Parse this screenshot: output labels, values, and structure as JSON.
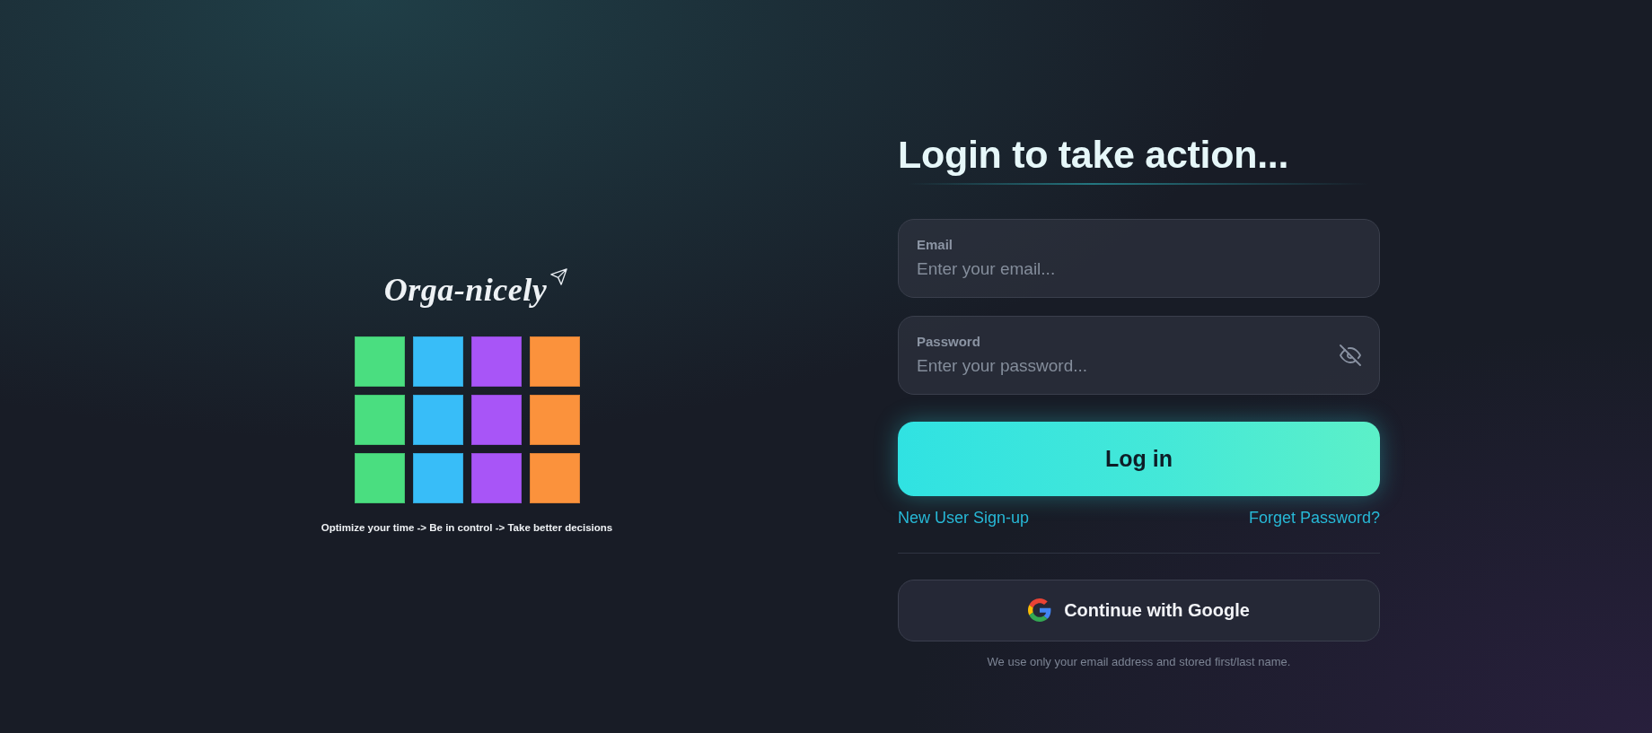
{
  "logo": {
    "wordmark": "Orga-nicely",
    "tile_rows": [
      {
        "tiles": [
          {
            "color": "#4ade80"
          },
          {
            "color": "#38bdf8"
          },
          {
            "color": "#a855f7"
          },
          {
            "color": "#fb923c"
          }
        ]
      },
      {
        "tiles": [
          {
            "color": "#4ade80"
          },
          {
            "color": "#38bdf8"
          },
          {
            "color": "#a855f7"
          },
          {
            "color": "#fb923c"
          }
        ]
      },
      {
        "tiles": [
          {
            "color": "#4ade80"
          },
          {
            "color": "#38bdf8"
          },
          {
            "color": "#a855f7"
          },
          {
            "color": "#fb923c"
          }
        ]
      }
    ],
    "tagline": "Optimize your time -> Be in control -> Take better decisions"
  },
  "login": {
    "title": "Login to take action...",
    "fields": [
      {
        "kind": "email",
        "label": "Email",
        "placeholder": "Enter your email..."
      },
      {
        "kind": "password",
        "label": "Password",
        "placeholder": "Enter your password...",
        "password_visible": false
      }
    ],
    "submit_button": "Log in",
    "links": [
      {
        "label": "New User Sign-up"
      },
      {
        "label": "Forget Password?"
      }
    ],
    "google_button": "Continue with Google",
    "privacy_note": "We use only your email address and stored first/last name."
  }
}
